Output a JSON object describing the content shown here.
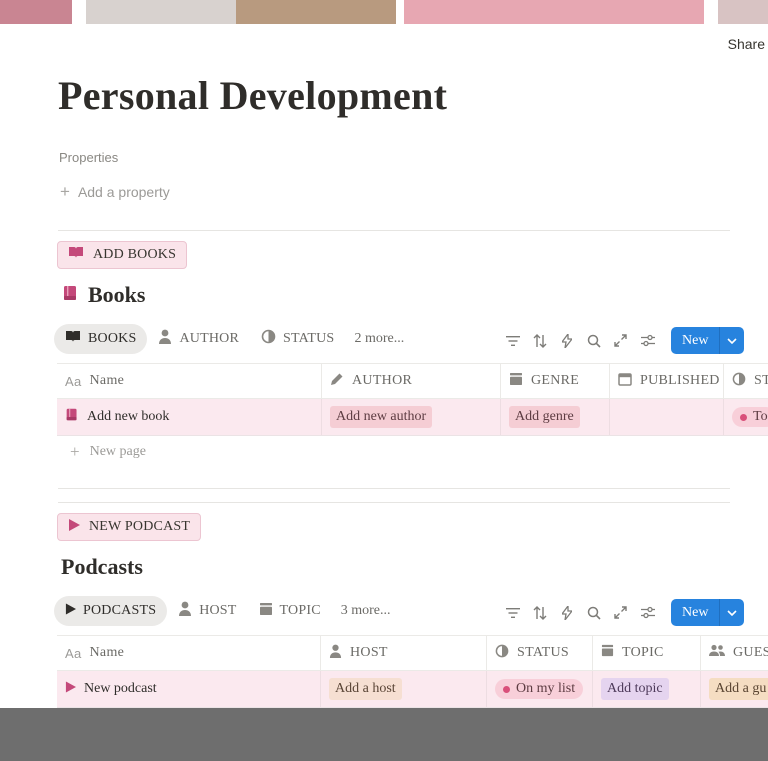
{
  "header": {
    "share_label": "Share"
  },
  "page": {
    "title": "Personal Development",
    "properties_label": "Properties",
    "add_property_label": "Add a property"
  },
  "books": {
    "button_label": "ADD BOOKS",
    "title": "Books",
    "tabs": [
      {
        "label": "BOOKS",
        "icon": "open-book-icon"
      },
      {
        "label": "AUTHOR",
        "icon": "person-icon"
      },
      {
        "label": "STATUS",
        "icon": "half-circle-icon"
      }
    ],
    "more_label": "2 more...",
    "new_label": "New",
    "columns": [
      {
        "label": "Name",
        "icon": "text-icon"
      },
      {
        "label": "AUTHOR",
        "icon": "pencil-icon"
      },
      {
        "label": "GENRE",
        "icon": "stack-icon"
      },
      {
        "label": "PUBLISHED",
        "icon": "calendar-icon"
      },
      {
        "label": "ST",
        "icon": "half-circle-icon"
      }
    ],
    "row": {
      "name": "Add new book",
      "author": "Add new author",
      "genre": "Add genre",
      "published": "",
      "status": "To"
    },
    "new_page_label": "New page"
  },
  "podcasts": {
    "button_label": "NEW PODCAST",
    "title": "Podcasts",
    "tabs": [
      {
        "label": "PODCASTS",
        "icon": "play-icon"
      },
      {
        "label": "HOST",
        "icon": "person-icon"
      },
      {
        "label": "TOPIC",
        "icon": "stack-icon"
      }
    ],
    "more_label": "3 more...",
    "new_label": "New",
    "columns": [
      {
        "label": "Name",
        "icon": "text-icon"
      },
      {
        "label": "HOST",
        "icon": "person-icon"
      },
      {
        "label": "STATUS",
        "icon": "half-circle-icon"
      },
      {
        "label": "TOPIC",
        "icon": "stack-icon"
      },
      {
        "label": "GUES",
        "icon": "people-icon"
      }
    ],
    "row": {
      "name": "New podcast",
      "host": "Add a host",
      "status": "On my list",
      "topic": "Add topic",
      "guest": "Add a gu"
    }
  },
  "colors": {
    "accent_blue": "#2783de",
    "row_highlight": "#fbe9ef",
    "icon_pink": "#c4497a"
  }
}
